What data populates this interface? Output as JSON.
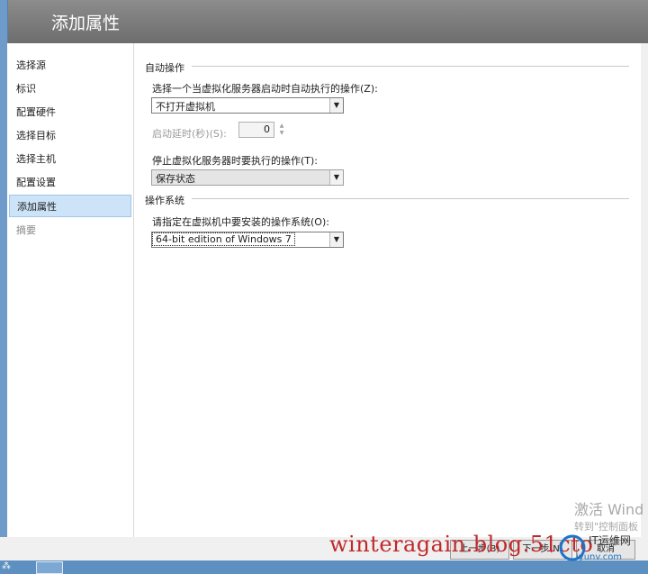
{
  "header": {
    "title": "添加属性"
  },
  "nav": {
    "items": [
      {
        "label": "选择源",
        "state": "normal"
      },
      {
        "label": "标识",
        "state": "normal"
      },
      {
        "label": "配置硬件",
        "state": "normal"
      },
      {
        "label": "选择目标",
        "state": "normal"
      },
      {
        "label": "选择主机",
        "state": "normal"
      },
      {
        "label": "配置设置",
        "state": "normal"
      },
      {
        "label": "添加属性",
        "state": "active"
      },
      {
        "label": "摘要",
        "state": "disabled"
      }
    ]
  },
  "auto_actions": {
    "section_title": "自动操作",
    "start_label": "选择一个当虚拟化服务器启动时自动执行的操作(Z):",
    "start_value": "不打开虚拟机",
    "delay_label": "启动延时(秒)(S):",
    "delay_value": "0",
    "stop_label": "停止虚拟化服务器时要执行的操作(T):",
    "stop_value": "保存状态"
  },
  "os": {
    "section_title": "操作系统",
    "label": "请指定在虚拟机中要安装的操作系统(O):",
    "value": "64-bit edition of Windows 7"
  },
  "footer": {
    "prev_label": "上一步(B)",
    "next_label": "下一步(N)",
    "cancel_label": "取消"
  },
  "overlay": {
    "watermark": "winteragain.blog.51cto",
    "activate_title": "激活 Wind",
    "activate_sub": "转到\"控制面板",
    "logo_text": "IT运维网",
    "logo_url": "iyunv.com"
  },
  "colors": {
    "header": "#7a7a7a",
    "active_nav": "#cde3f7",
    "taskbar": "#5d8fc0",
    "watermark": "#c0282a"
  }
}
